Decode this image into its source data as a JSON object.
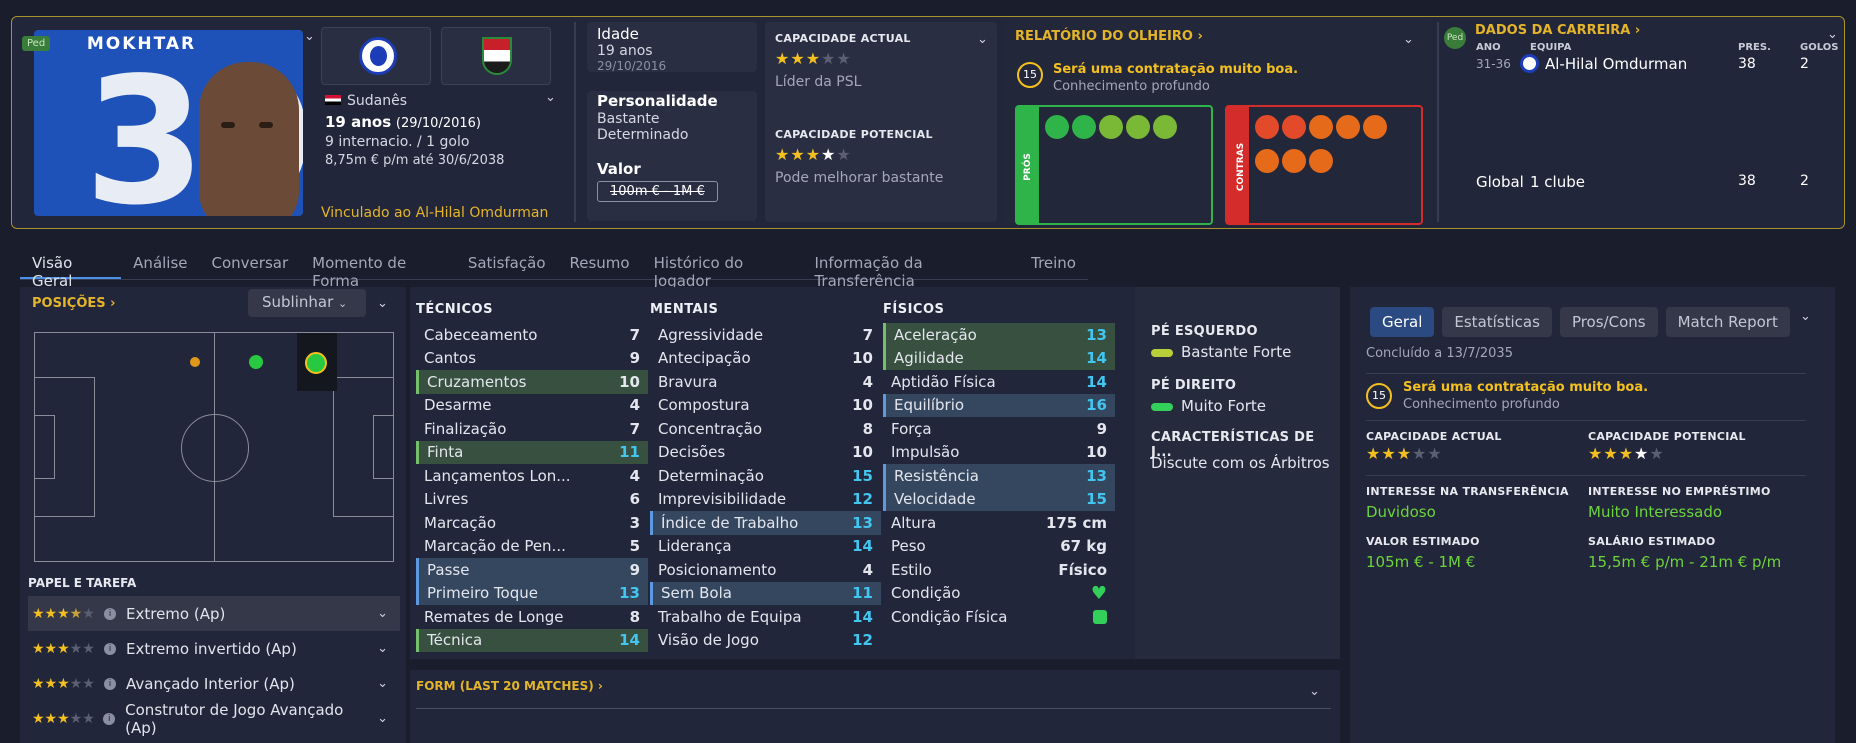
{
  "player": {
    "name": "MOKHTAR",
    "number": "39",
    "ped": "Ped",
    "nationality": "Sudanês",
    "age_line": "19 anos",
    "dob_paren": "(29/10/2016)",
    "caps": "9 internacio. / 1 golo",
    "wage": "8,75m € p/m até 30/6/2038",
    "linked": "Vinculado ao Al-Hilal Omdurman"
  },
  "info": {
    "age_label": "Idade",
    "age": "19 anos",
    "dob": "29/10/2016",
    "pers_label": "Personalidade",
    "pers1": "Bastante",
    "pers2": "Determinado",
    "value_label": "Valor",
    "value": "100m € - 1M €"
  },
  "ability": {
    "ca_label": "CAPACIDADE ACTUAL",
    "ca_desc": "Líder da PSL",
    "pa_label": "CAPACIDADE POTENCIAL",
    "pa_desc": "Pode melhorar bastante",
    "ca_stars": 3,
    "pa_stars": 3.5
  },
  "scout": {
    "title": "RELATÓRIO DO OLHEIRO",
    "score": "15",
    "verdict": "Será uma contratação muito boa.",
    "knowledge": "Conhecimento profundo",
    "pros": "PRÓS",
    "cons": "CONTRAS"
  },
  "career": {
    "title": "DADOS DA CARREIRA",
    "col_year": "ANO",
    "col_team": "EQUIPA",
    "col_apps": "PRES.",
    "col_goals": "GOLOS",
    "year": "31-36",
    "team": "Al-Hilal Omdurman",
    "apps": "38",
    "goals": "2",
    "total_label": "Global",
    "total_clubs": "1 clube",
    "total_apps": "38",
    "total_goals": "2",
    "ped": "Ped"
  },
  "tabs": [
    "Visão Geral",
    "Análise",
    "Conversar",
    "Momento de Forma",
    "Satisfação",
    "Resumo",
    "Histórico do Jogador",
    "Informação da Transferência",
    "Treino"
  ],
  "positions": {
    "title": "POSIÇÕES",
    "highlight": "Sublinhar",
    "roles_title": "PAPEL E TAREFA",
    "roles": [
      {
        "name": "Extremo (Ap)",
        "stars": "★★★★",
        "half": "½"
      },
      {
        "name": "Extremo invertido (Ap)",
        "stars": "★★★"
      },
      {
        "name": "Avançado Interior (Ap)",
        "stars": "★★★"
      },
      {
        "name": "Construtor de Jogo Avançado (Ap)",
        "stars": "★★★"
      }
    ]
  },
  "attrs": {
    "tech_title": "TÉCNICOS",
    "ment_title": "MENTAIS",
    "phys_title": "FÍSICOS",
    "tech": [
      [
        "Cabeceamento",
        "7",
        ""
      ],
      [
        "Cantos",
        "9",
        ""
      ],
      [
        "Cruzamentos",
        "10",
        "g"
      ],
      [
        "Desarme",
        "4",
        ""
      ],
      [
        "Finalização",
        "7",
        ""
      ],
      [
        "Finta",
        "11",
        "g"
      ],
      [
        "Lançamentos Lon...",
        "4",
        ""
      ],
      [
        "Livres",
        "6",
        ""
      ],
      [
        "Marcação",
        "3",
        ""
      ],
      [
        "Marcação de Pen...",
        "5",
        ""
      ],
      [
        "Passe",
        "9",
        "b"
      ],
      [
        "Primeiro Toque",
        "13",
        "b"
      ],
      [
        "Remates de Longe",
        "8",
        ""
      ],
      [
        "Técnica",
        "14",
        "g"
      ]
    ],
    "ment": [
      [
        "Agressividade",
        "7",
        ""
      ],
      [
        "Antecipação",
        "10",
        ""
      ],
      [
        "Bravura",
        "4",
        ""
      ],
      [
        "Compostura",
        "10",
        ""
      ],
      [
        "Concentração",
        "8",
        ""
      ],
      [
        "Decisões",
        "10",
        ""
      ],
      [
        "Determinação",
        "15",
        ""
      ],
      [
        "Imprevisibilidade",
        "12",
        ""
      ],
      [
        "Índice de Trabalho",
        "13",
        "b"
      ],
      [
        "Liderança",
        "14",
        ""
      ],
      [
        "Posicionamento",
        "4",
        ""
      ],
      [
        "Sem Bola",
        "11",
        "b"
      ],
      [
        "Trabalho de Equipa",
        "14",
        ""
      ],
      [
        "Visão de Jogo",
        "12",
        ""
      ]
    ],
    "phys": [
      [
        "Aceleração",
        "13",
        "g"
      ],
      [
        "Agilidade",
        "14",
        "g"
      ],
      [
        "Aptidão Física",
        "14",
        ""
      ],
      [
        "Equilíbrio",
        "16",
        "b"
      ],
      [
        "Força",
        "9",
        ""
      ],
      [
        "Impulsão",
        "10",
        ""
      ],
      [
        "Resistência",
        "13",
        "b"
      ],
      [
        "Velocidade",
        "15",
        "b"
      ]
    ],
    "extra": [
      [
        "Altura",
        "175 cm"
      ],
      [
        "Peso",
        "67 kg"
      ],
      [
        "Estilo",
        "Físico"
      ],
      [
        "Condição",
        ""
      ],
      [
        "Condição Física",
        ""
      ]
    ]
  },
  "feet": {
    "left_label": "PÉ ESQUERDO",
    "left": "Bastante Forte",
    "right_label": "PÉ DIREITO",
    "right": "Muito Forte",
    "traits_label": "CARACTERÍSTICAS DE J...",
    "trait": "Discute com os Árbitros"
  },
  "form": {
    "title": "FORM (LAST 20 MATCHES)"
  },
  "report": {
    "tabs": [
      "Geral",
      "Estatísticas",
      "Pros/Cons",
      "Match Report"
    ],
    "done": "Concluído a 13/7/2035",
    "score": "15",
    "verdict": "Será uma contratação muito boa.",
    "knowledge": "Conhecimento profundo",
    "ca": "CAPACIDADE ACTUAL",
    "pa": "CAPACIDADE POTENCIAL",
    "ti_label": "INTERESSE NA TRANSFERÊNCIA",
    "ti": "Duvidoso",
    "li_label": "INTERESSE NO EMPRÉSTIMO",
    "li": "Muito Interessado",
    "ev_label": "VALOR ESTIMADO",
    "ev": "105m € - 1M €",
    "es_label": "SALÁRIO ESTIMADO",
    "es": "15,5m € p/m - 21m € p/m"
  },
  "colors": {
    "accent": "#e4b52a",
    "green": "#6cd43c",
    "cyan": "#42c6f0"
  }
}
